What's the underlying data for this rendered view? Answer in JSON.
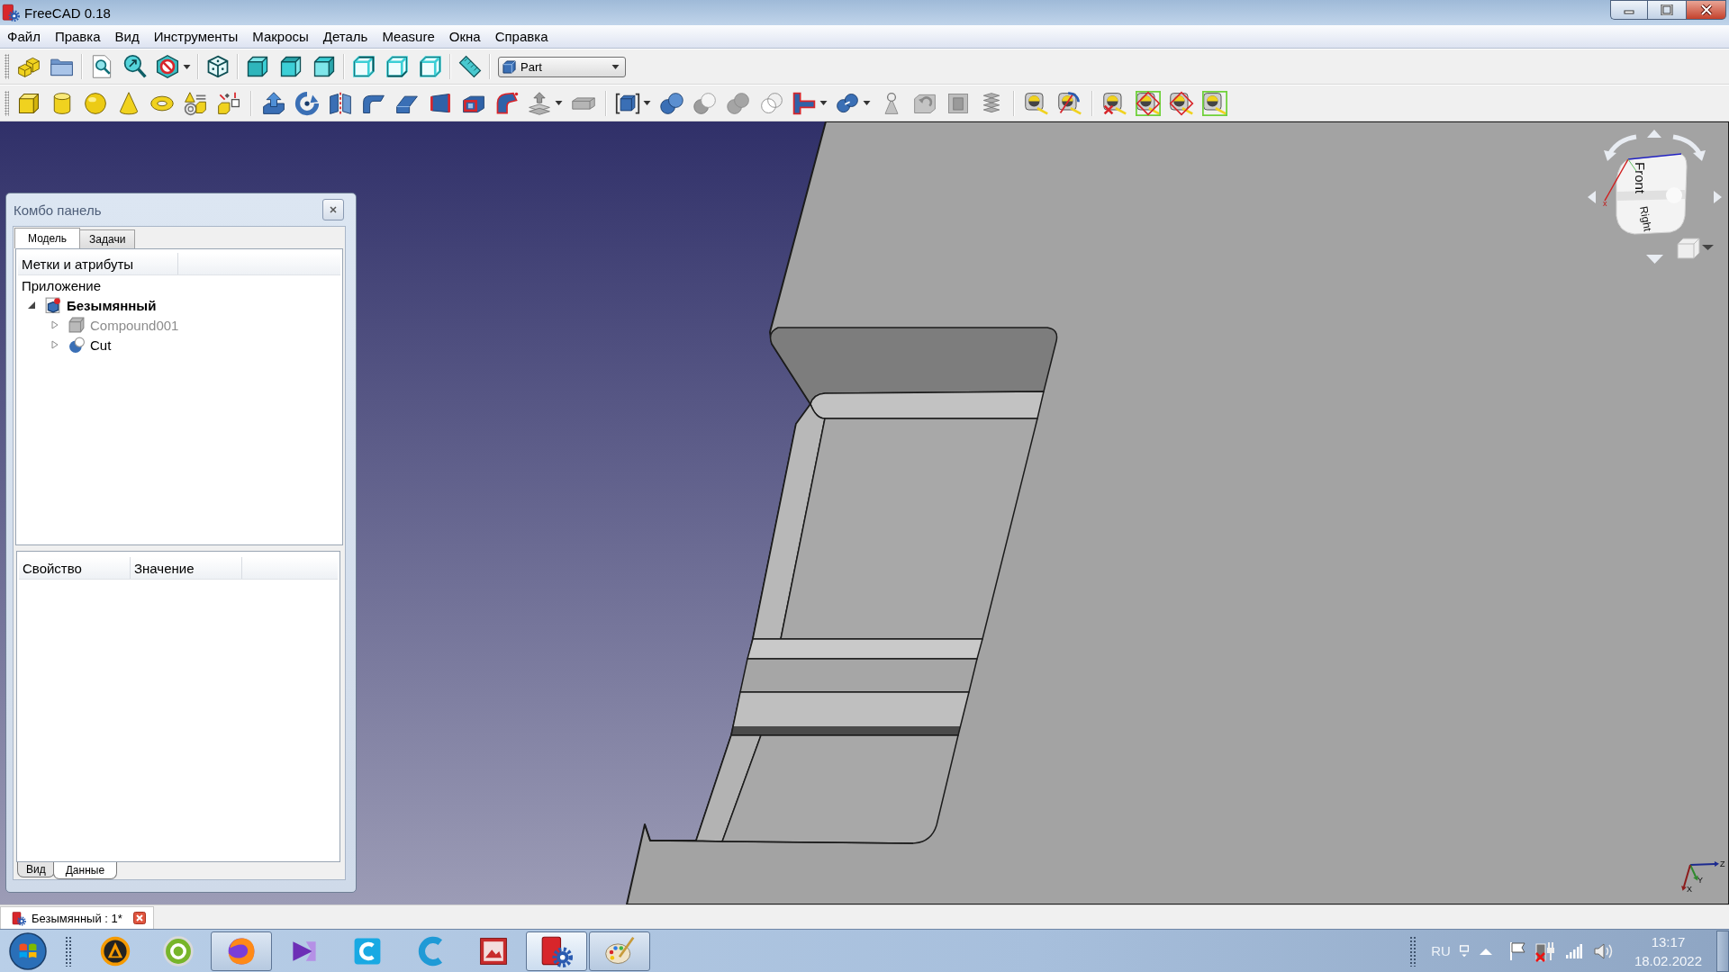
{
  "window": {
    "title": "FreeCAD 0.18"
  },
  "menu": [
    "Файл",
    "Правка",
    "Вид",
    "Инструменты",
    "Макросы",
    "Деталь",
    "Measure",
    "Окна",
    "Справка"
  ],
  "workbench": {
    "label": "Part"
  },
  "viewport": {
    "nav_cube": {
      "faces": [
        "Front",
        "Right"
      ],
      "axis_label": "x"
    },
    "axes": [
      {
        "label": "Z",
        "color": "#1c2a8f"
      },
      {
        "label": "Y",
        "color": "#2f8a2f"
      },
      {
        "label": "X",
        "color": "#8c1c1c"
      }
    ]
  },
  "combo_panel": {
    "title": "Комбо панель",
    "tabs": [
      {
        "label": "Модель",
        "selected": true
      },
      {
        "label": "Задачи",
        "selected": false
      }
    ],
    "tree": {
      "columns": [
        "Метки и атрибуты"
      ],
      "root": "Приложение",
      "items": [
        {
          "label": "Безымянный",
          "kind": "document",
          "expanded": true,
          "children": [
            {
              "label": "Compound001",
              "kind": "compound",
              "expanded": false,
              "visible": false
            },
            {
              "label": "Cut",
              "kind": "cut",
              "expanded": false,
              "visible": true
            }
          ]
        }
      ]
    },
    "properties": {
      "columns": [
        "Свойство",
        "Значение"
      ]
    },
    "view_tabs": [
      {
        "label": "Вид",
        "selected": false
      },
      {
        "label": "Данные",
        "selected": true
      }
    ]
  },
  "document_tabs": [
    {
      "label": "Безымянный : 1*",
      "selected": true
    }
  ],
  "taskbar": {
    "apps": [
      {
        "running": false,
        "active": false
      },
      {
        "running": false,
        "active": false
      },
      {
        "running": true,
        "active": false
      },
      {
        "running": false,
        "active": false
      },
      {
        "running": false,
        "active": false
      },
      {
        "running": false,
        "active": false
      },
      {
        "running": false,
        "active": false
      },
      {
        "running": true,
        "active": true
      },
      {
        "running": true,
        "active": false
      }
    ],
    "tray": {
      "language": "RU",
      "time": "13:17",
      "date": "18.02.2022"
    }
  }
}
